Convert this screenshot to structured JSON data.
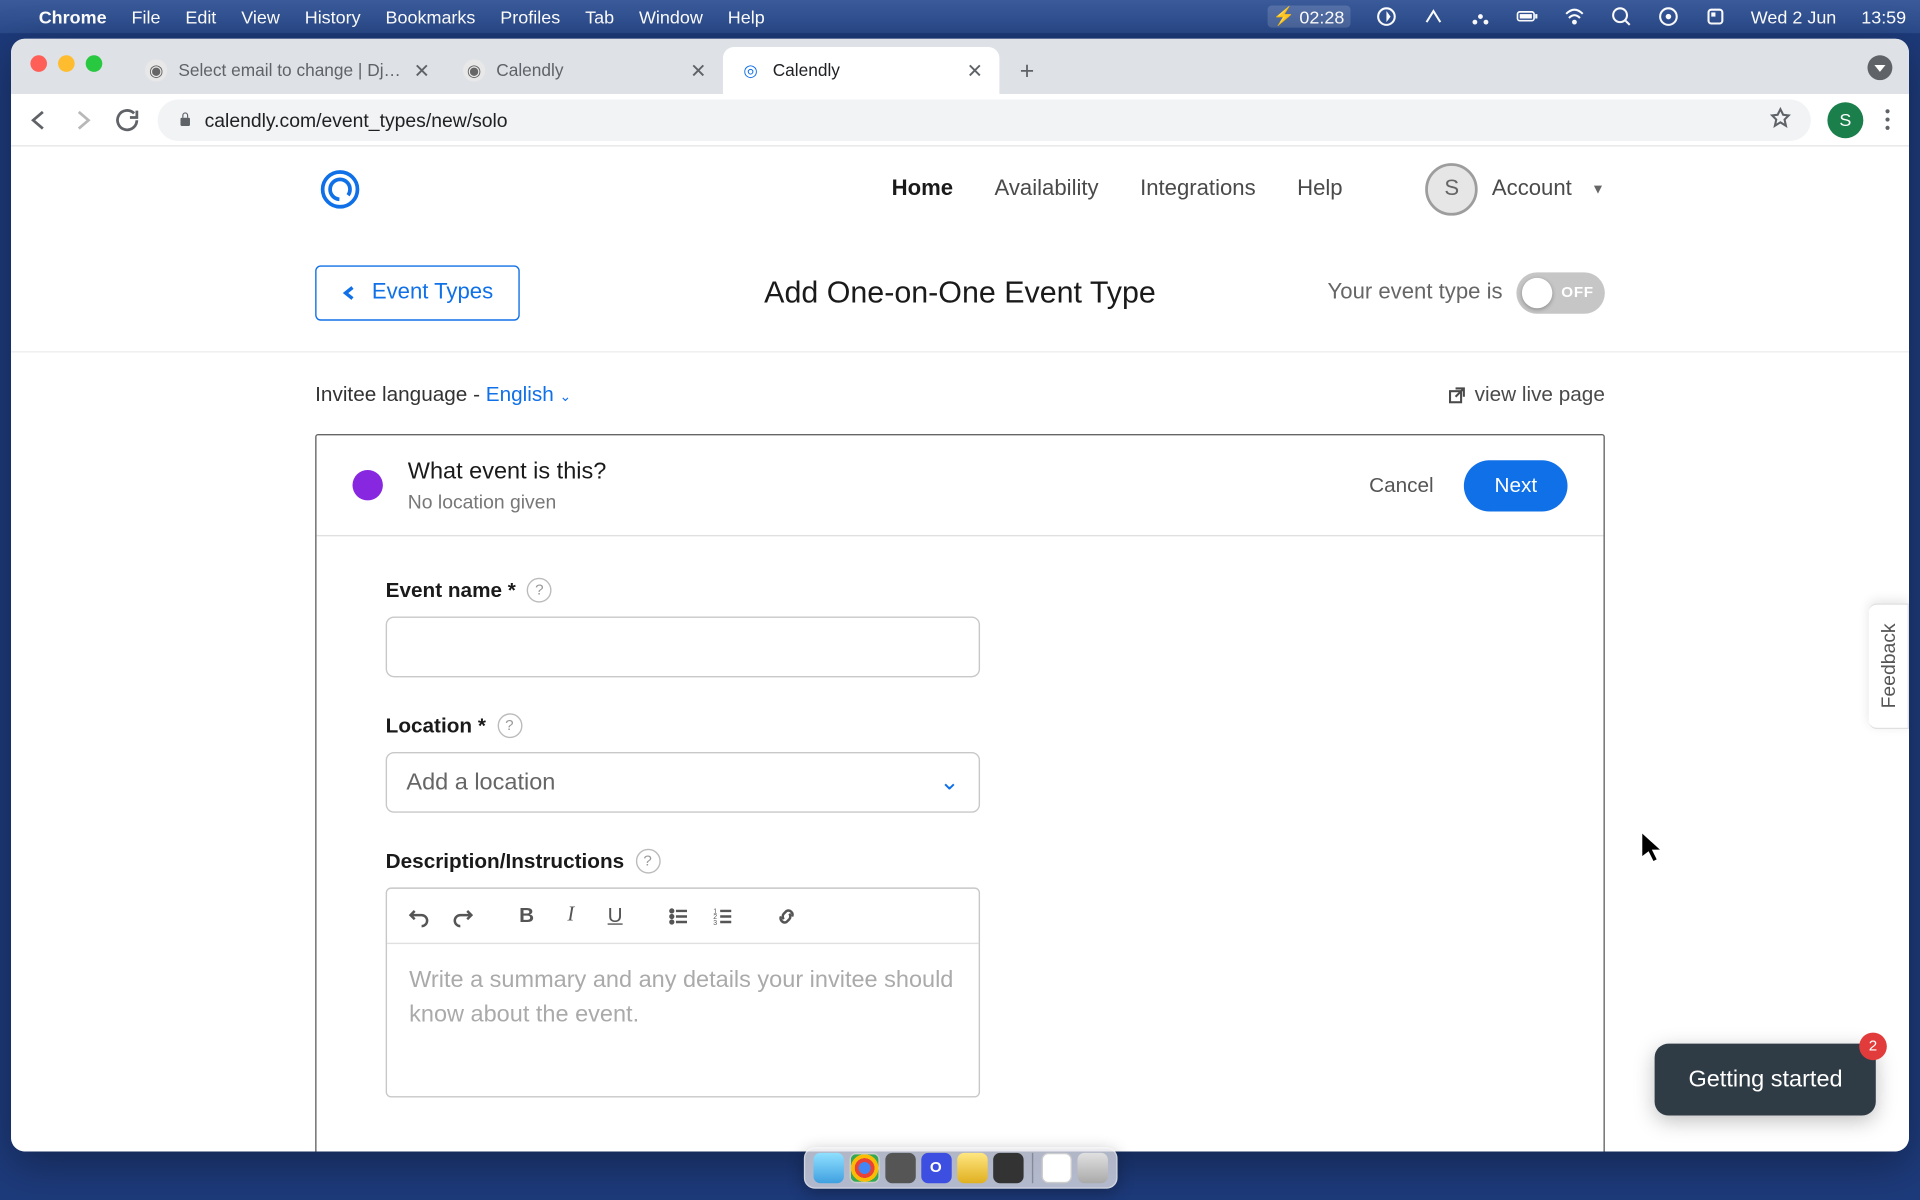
{
  "mac_menu": {
    "app": "Chrome",
    "items": [
      "File",
      "Edit",
      "View",
      "History",
      "Bookmarks",
      "Profiles",
      "Tab",
      "Window",
      "Help"
    ],
    "timer": "02:28",
    "date": "Wed 2 Jun",
    "clock": "13:59"
  },
  "tabs": [
    {
      "title": "Select email to change | Django",
      "active": false
    },
    {
      "title": "Calendly",
      "active": false
    },
    {
      "title": "Calendly",
      "active": true
    }
  ],
  "url": "calendly.com/event_types/new/solo",
  "profile_initial": "S",
  "nav": {
    "links": [
      "Home",
      "Availability",
      "Integrations",
      "Help"
    ],
    "active": "Home",
    "account_label": "Account",
    "avatar_initial": "S"
  },
  "head": {
    "back": "Event Types",
    "title": "Add One-on-One Event Type",
    "toggle_prefix": "Your event type is",
    "toggle_state": "OFF"
  },
  "subrow": {
    "lang_prefix": "Invitee language - ",
    "lang_value": "English",
    "view_live": "view live page"
  },
  "card": {
    "question": "What event is this?",
    "subtitle": "No location given",
    "cancel": "Cancel",
    "next": "Next",
    "event_name_label": "Event name *",
    "location_label": "Location *",
    "location_placeholder": "Add a location",
    "description_label": "Description/Instructions",
    "description_placeholder": "Write a summary and any details your invitee should know about the event."
  },
  "feedback": "Feedback",
  "getting_started": {
    "label": "Getting started",
    "count": "2"
  }
}
